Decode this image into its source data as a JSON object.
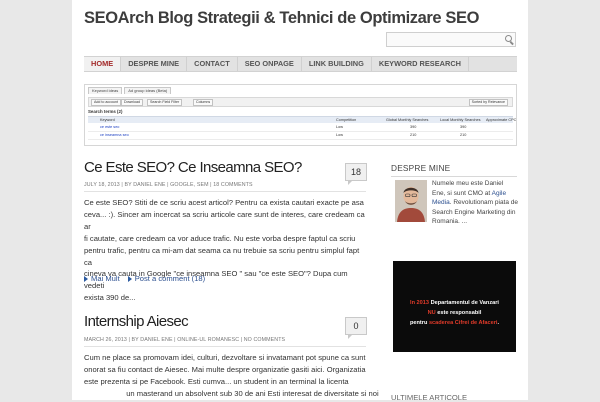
{
  "site": {
    "title": "SEOArch Blog  Strategii & Tehnici de Optimizare SEO"
  },
  "search": {
    "placeholder": ""
  },
  "nav": {
    "items": [
      "HOME",
      "DESPRE MINE",
      "CONTACT",
      "SEO ONPAGE",
      "LINK BUILDING",
      "KEYWORD RESEARCH"
    ],
    "active_index": 0
  },
  "banner": {
    "tabs": [
      "Keyword ideas",
      "Ad group ideas (Beta)"
    ],
    "toolbar": [
      "Add to account",
      "Download",
      "Search Field Filter",
      "Columns"
    ],
    "sort_label": "Sorted by Relevance",
    "section": "Search terms (2)",
    "columns": [
      "Keyword",
      "Competition",
      "Global Monthly Searches",
      "Local Monthly Searches",
      "Approximate CPC"
    ],
    "rows": [
      {
        "keyword": "ce este seo",
        "competition": "Low",
        "global": "390",
        "local": "390"
      },
      {
        "keyword": "ce inseamna seo",
        "competition": "Low",
        "global": "210",
        "local": "210"
      }
    ]
  },
  "posts": [
    {
      "title": "Ce Este SEO? Ce Inseamna SEO?",
      "meta": "JULY 18, 2013 | BY DANIEL ENE | GOOGLE, SEM | 18 COMMENTS",
      "comments": "18",
      "excerpt_lines": [
        "Ce este SEO? Stiti  de ce scriu acest articol? Pentru ca exista cautari exacte pe asa",
        "ceva... :). Sincer am incercat sa scriu articole care sunt de interes, care credeam ca ar",
        "fi cautate, care credeam ca vor aduce trafic. Nu este vorba despre faptul ca scriu",
        "pentru trafic, pentru ca mi-am dat seama ca nu trebuie sa scriu pentru simplul fapt ca",
        "cineva va cauta in Google \"ce inseamna SEO \" sau \"ce este SEO\"? Dupa cum vedeti",
        "exista 390 de..."
      ],
      "read_more": "Mai Mult",
      "add_comment": "Post a comment (18)"
    },
    {
      "title": "Internship Aiesec",
      "meta": "MARCH 26, 2013 | BY DANIEL ENE | ONLINE-UL ROMANESC | NO COMMENTS",
      "comments": "0",
      "excerpt_lines": [
        "Cum ne place sa promovam idei, culturi, dezvoltare si invatamant pot spune ca sunt",
        "onorat sa fiu contact de Aiesec. Mai multe despre organizatie gasiti aici. Organizatia",
        "este prezenta si pe Facebook. Esti cumva...     un student in an terminal la licenta",
        "                    un masterand un absolvent sub 30 de ani Esti interesat de diversitate si noi"
      ]
    }
  ],
  "sidebar": {
    "about_title": "DESPRE MINE",
    "about_prefix": "Numele meu este Daniel Ene, si sunt CMO at ",
    "about_link": "Agile Media",
    "about_suffix": ". Revolutionam piata de Search Engine Marketing din Romania. ...",
    "promo": {
      "line1_year": "In 2013",
      "line1_rest": " Departamentul de Vanzari",
      "line2_red": "NU",
      "line2_rest": " este responsabil",
      "line3_pre": "pentru ",
      "line3_red": "scaderea Cifrei de Afaceri",
      "line3_post": "."
    },
    "next_title": "ULTIMELE ARTICOLE"
  },
  "colors": {
    "accent": "#a32b2b",
    "link": "#2b4f8f",
    "promo_red": "#e23b2a"
  }
}
